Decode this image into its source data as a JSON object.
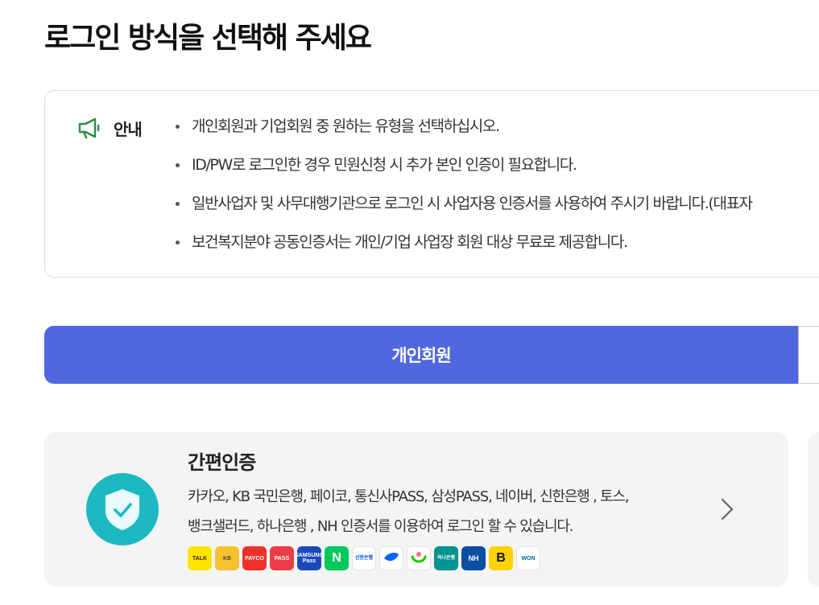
{
  "page": {
    "title": "로그인 방식을 선택해 주세요"
  },
  "notice": {
    "label": "안내",
    "items": [
      "개인회원과 기업회원 중 원하는 유형을 선택하십시오.",
      "ID/PW로 로그인한 경우 민원신청 시 추가 본인 인증이 필요합니다.",
      "일반사업자 및 사무대행기관으로 로그인 시 사업자용 인증서를 사용하여 주시기 바랍니다.(대표자",
      "보건복지분야 공동인증서는 개인/기업 사업장 회원 대상 무료로 제공합니다."
    ]
  },
  "tabs": {
    "personal": "개인회원"
  },
  "simple_auth": {
    "title": "간편인증",
    "desc_line1": "카카오, KB 국민은행, 페이코, 통신사PASS, 삼성PASS, 네이버, 신한은행 , 토스,",
    "desc_line2": "뱅크샐러드, 하나은행 , NH 인증서를 이용하여 로그인 할 수 있습니다.",
    "providers": [
      {
        "name": "kakao",
        "label": "TALK",
        "bg": "#fee500",
        "fg": "#3c1e1e"
      },
      {
        "name": "kb",
        "label": "KB",
        "bg": "#f7c231",
        "fg": "#5a4a2a"
      },
      {
        "name": "payco",
        "label": "PAYCO",
        "bg": "#f0302b",
        "fg": "#ffffff"
      },
      {
        "name": "pass",
        "label": "PASS",
        "bg": "#eb3c47",
        "fg": "#ffffff"
      },
      {
        "name": "samsung-pass",
        "label": "SAMSUNG Pass",
        "bg": "#1b4ab8",
        "fg": "#ffffff"
      },
      {
        "name": "naver",
        "label": "N",
        "bg": "#03c75a",
        "fg": "#ffffff"
      },
      {
        "name": "shinhan",
        "label": "신한은행",
        "bg": "#ffffff",
        "fg": "#0046ff"
      },
      {
        "name": "toss",
        "label": "",
        "bg": "#ffffff",
        "fg": "#0064ff"
      },
      {
        "name": "banksalad",
        "label": "",
        "bg": "#ffffff",
        "fg": "#1ec800"
      },
      {
        "name": "hana",
        "label": "하나은행",
        "bg": "#009490",
        "fg": "#ffffff"
      },
      {
        "name": "nh",
        "label": "NH",
        "bg": "#0b4ea2",
        "fg": "#ffffff"
      },
      {
        "name": "b",
        "label": "B",
        "bg": "#ffd200",
        "fg": "#111111"
      },
      {
        "name": "won",
        "label": "WON",
        "bg": "#ffffff",
        "fg": "#0067ac"
      }
    ]
  },
  "colors": {
    "accent": "#5067e0",
    "shield": "#1db9c3",
    "notice_icon": "#2e8b3e"
  }
}
